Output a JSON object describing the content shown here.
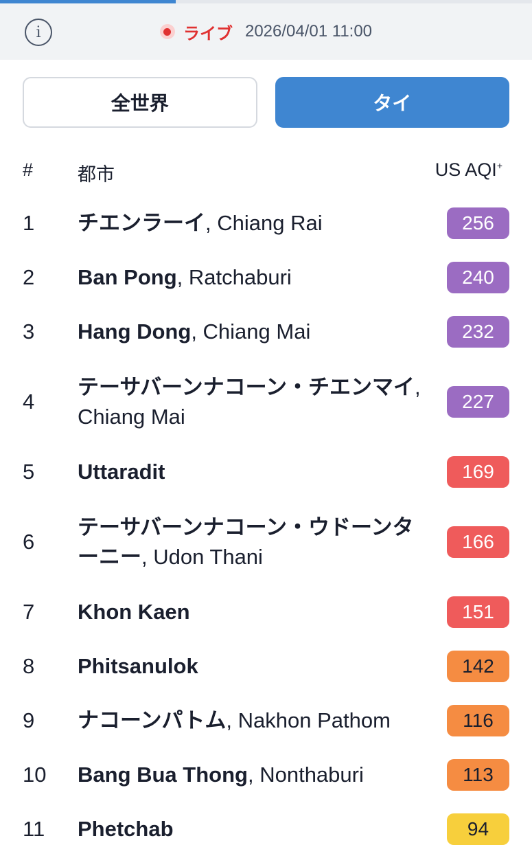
{
  "progress": {
    "fraction": 0.33
  },
  "status": {
    "info_icon": "info-icon",
    "live_label": "ライブ",
    "timestamp": "2026/04/01 11:00"
  },
  "tabs": [
    {
      "label": "全世界",
      "active": false
    },
    {
      "label": "タイ",
      "active": true
    }
  ],
  "table": {
    "headers": {
      "rank": "#",
      "city": "都市",
      "aqi": "US AQI",
      "aqi_mark": "+"
    },
    "rows": [
      {
        "rank": "1",
        "name": "チエンラーイ",
        "region": ", Chiang Rai",
        "aqi": "256",
        "color": "#9b6cc2"
      },
      {
        "rank": "2",
        "name": "Ban Pong",
        "region": ", Ratchaburi",
        "aqi": "240",
        "color": "#9b6cc2"
      },
      {
        "rank": "3",
        "name": "Hang Dong",
        "region": ", Chiang Mai",
        "aqi": "232",
        "color": "#9b6cc2"
      },
      {
        "rank": "4",
        "name": "テーサバーンナコーン・チエンマイ",
        "region": ", Chiang Mai",
        "aqi": "227",
        "color": "#9b6cc2"
      },
      {
        "rank": "5",
        "name": "Uttaradit",
        "region": "",
        "aqi": "169",
        "color": "#ef5b5b"
      },
      {
        "rank": "6",
        "name": "テーサバーンナコーン・ウドーンターニー",
        "region": ", Udon Thani",
        "aqi": "166",
        "color": "#ef5b5b"
      },
      {
        "rank": "7",
        "name": "Khon Kaen",
        "region": "",
        "aqi": "151",
        "color": "#ef5b5b"
      },
      {
        "rank": "8",
        "name": "Phitsanulok",
        "region": "",
        "aqi": "142",
        "color": "#f58c42"
      },
      {
        "rank": "9",
        "name": "ナコーンパトム",
        "region": ", Nakhon Pathom",
        "aqi": "116",
        "color": "#f58c42"
      },
      {
        "rank": "10",
        "name": "Bang Bua Thong",
        "region": ", Nonthaburi",
        "aqi": "113",
        "color": "#f58c42"
      },
      {
        "rank": "11",
        "name": "Phetchab",
        "region": "",
        "aqi": "94",
        "color": "#f7cf3c"
      }
    ]
  }
}
